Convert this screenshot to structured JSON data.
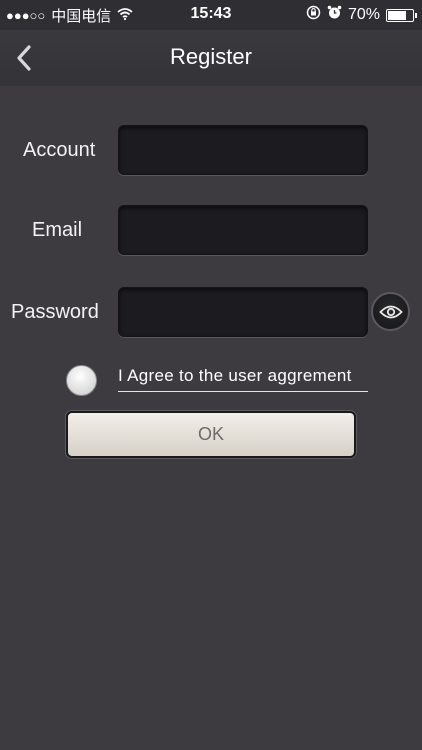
{
  "status_bar": {
    "signal": "●●●○○",
    "carrier": "中国电信",
    "wifi_icon": "wifi-icon",
    "time": "15:43",
    "battery_percent": "70%",
    "battery_level": 0.7
  },
  "nav": {
    "title": "Register",
    "back_icon": "chevron-left-icon"
  },
  "form": {
    "account_label": "Account",
    "account_value": "",
    "email_label": "Email",
    "email_value": "",
    "password_label": "Password",
    "password_value": "",
    "show_password_icon": "eye-icon",
    "agree_text": "I Agree to the user aggrement",
    "agree_checked": false,
    "ok_label": "OK"
  },
  "colors": {
    "background": "#3d3b40",
    "input_background": "#1c1b1f",
    "button_background": "#e8e3dc",
    "button_text": "#6f6b66"
  }
}
